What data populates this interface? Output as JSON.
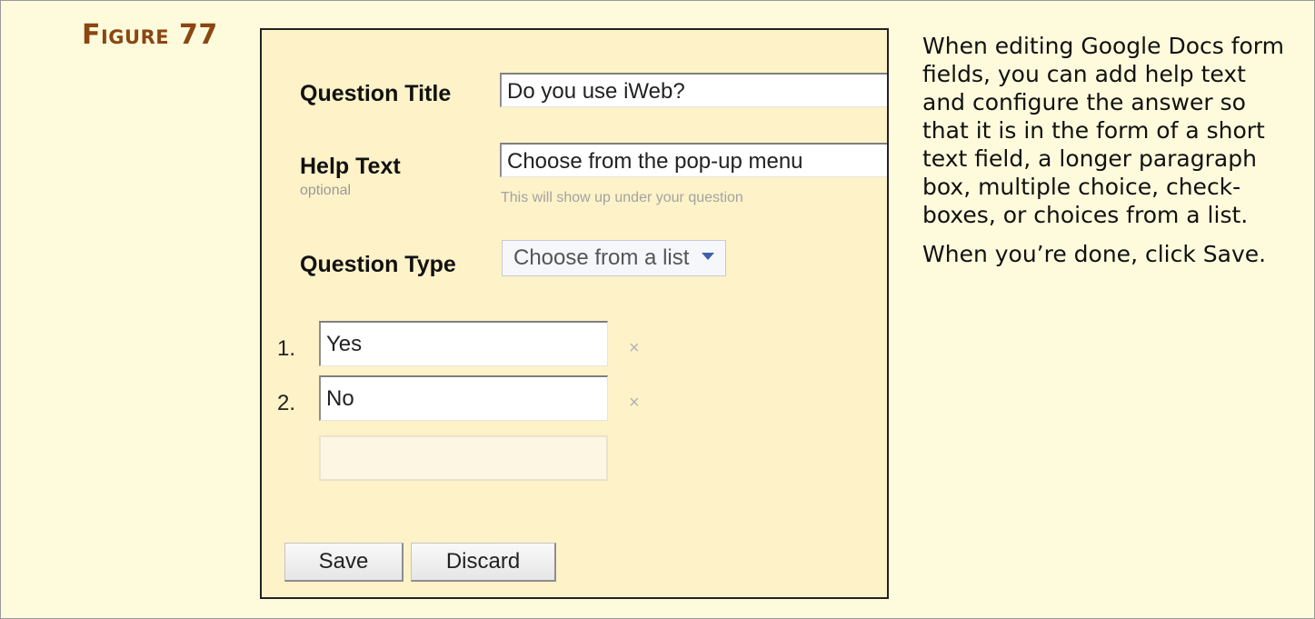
{
  "figure": {
    "label": "Figure 77"
  },
  "form": {
    "question_title": {
      "label": "Question Title",
      "value": "Do you use iWeb?"
    },
    "help_text": {
      "label": "Help Text",
      "sublabel": "optional",
      "value": "Choose from the pop-up menu",
      "hint": "This will show up under your question"
    },
    "question_type": {
      "label": "Question Type",
      "selected": "Choose from a list"
    },
    "choices": [
      {
        "number": "1.",
        "value": "Yes",
        "remove": "×"
      },
      {
        "number": "2.",
        "value": "No",
        "remove": "×"
      }
    ],
    "buttons": {
      "save": "Save",
      "discard": "Discard"
    }
  },
  "caption": {
    "paragraph1": "When editing Google Docs form fields, you can add help text and configure the answer so that it is in the form of a short text field, a longer paragraph box, multiple choice, check-boxes, or choices from a list.",
    "paragraph2": "When you’re done, click Save."
  },
  "colors": {
    "page_background": "#fefbdc",
    "screenshot_background": "#fdf2c8",
    "figure_label": "#8b4612",
    "select_caret": "#3f5fa7"
  }
}
